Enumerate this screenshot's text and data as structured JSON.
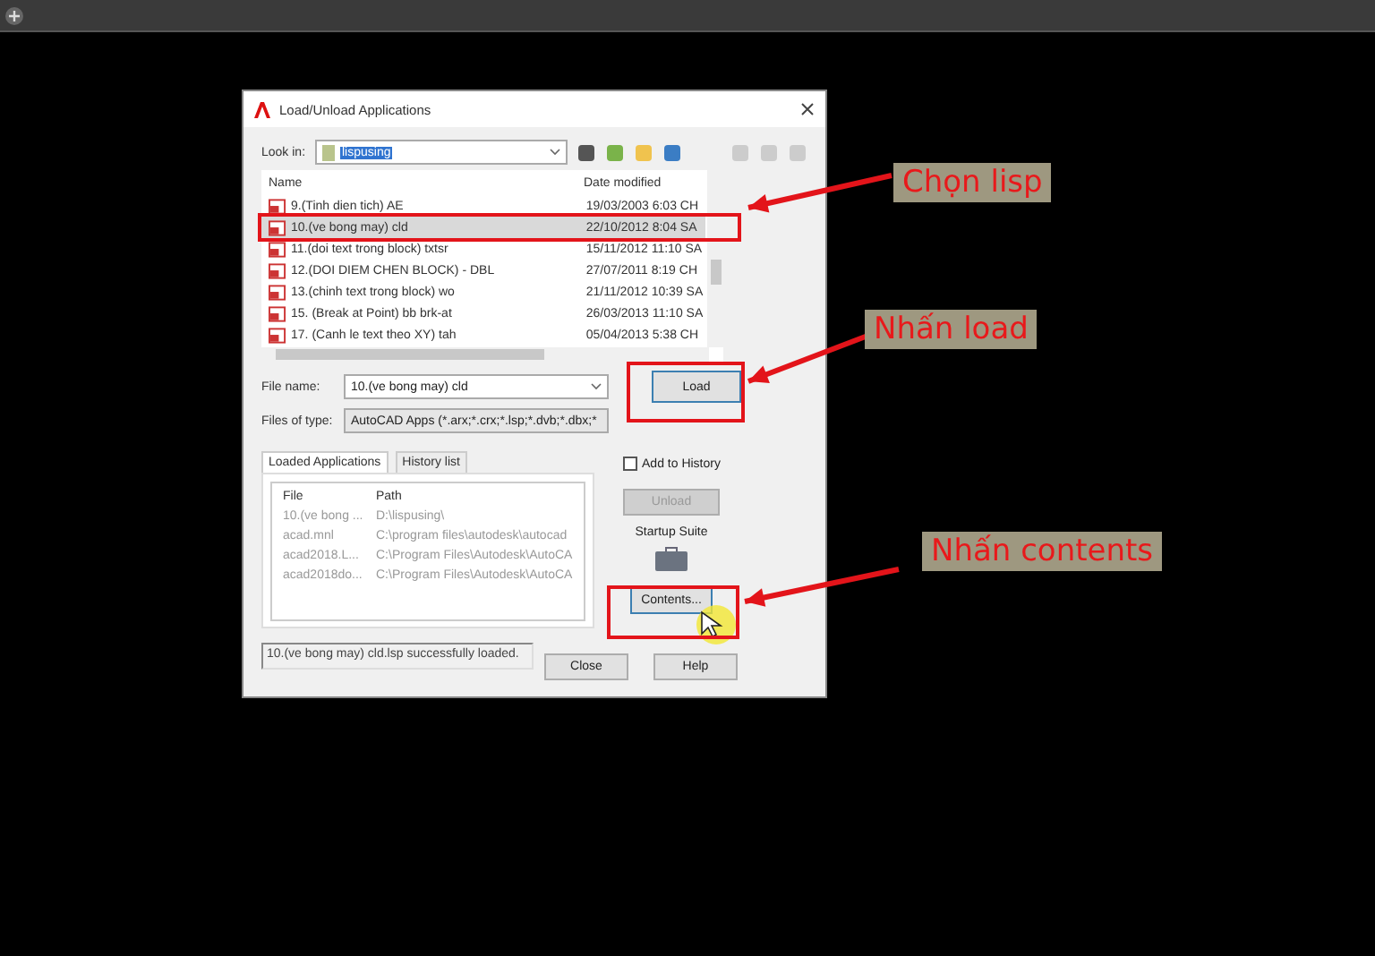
{
  "dialog": {
    "title": "Load/Unload Applications",
    "look_in": {
      "label": "Look in:",
      "value": "lispusing"
    },
    "file_list": {
      "columns": [
        "Name",
        "Date modified"
      ],
      "rows": [
        {
          "name": "9.(Tinh dien tich) AE",
          "date": "19/03/2003 6:03 CH",
          "selected": false
        },
        {
          "name": "10.(ve bong may) cld",
          "date": "22/10/2012 8:04 SA",
          "selected": true
        },
        {
          "name": "11.(doi text trong block) txtsr",
          "date": "15/11/2012 11:10 SA",
          "selected": false
        },
        {
          "name": "12.(DOI DIEM CHEN BLOCK) - DBL",
          "date": "27/07/2011 8:19 CH",
          "selected": false
        },
        {
          "name": "13.(chinh text trong block) wo",
          "date": "21/11/2012 10:39 SA",
          "selected": false
        },
        {
          "name": "15. (Break at Point) bb brk-at",
          "date": "26/03/2013 11:10 SA",
          "selected": false
        },
        {
          "name": "17. (Canh le text theo XY) tah",
          "date": "05/04/2013 5:38 CH",
          "selected": false
        }
      ]
    },
    "file_name": {
      "label": "File name:",
      "value": "10.(ve bong may) cld"
    },
    "files_of_type": {
      "label": "Files of type:",
      "value": "AutoCAD Apps (*.arx;*.crx;*.lsp;*.dvb;*.dbx;*"
    },
    "load_button": "Load",
    "tabs": [
      {
        "label": "Loaded Applications",
        "selected": true
      },
      {
        "label": "History list",
        "selected": false
      }
    ],
    "loaded_table": {
      "columns": [
        "File",
        "Path"
      ],
      "rows": [
        {
          "file": "10.(ve bong ...",
          "path": "D:\\lispusing\\"
        },
        {
          "file": "acad.mnl",
          "path": "C:\\program files\\autodesk\\autocad"
        },
        {
          "file": "acad2018.L...",
          "path": "C:\\Program Files\\Autodesk\\AutoCA"
        },
        {
          "file": "acad2018do...",
          "path": "C:\\Program Files\\Autodesk\\AutoCA"
        }
      ]
    },
    "add_to_history": {
      "label": "Add to History",
      "checked": false
    },
    "unload_button": {
      "label": "Unload",
      "disabled": true
    },
    "startup_suite": "Startup Suite",
    "contents_button": "Contents...",
    "status": "10.(ve bong may) cld.lsp successfully loaded.",
    "buttons": [
      "Close",
      "Help"
    ]
  },
  "annotations": [
    {
      "label": "Chọn lisp"
    },
    {
      "label": "Nhấn load"
    },
    {
      "label": "Nhấn contents"
    }
  ]
}
